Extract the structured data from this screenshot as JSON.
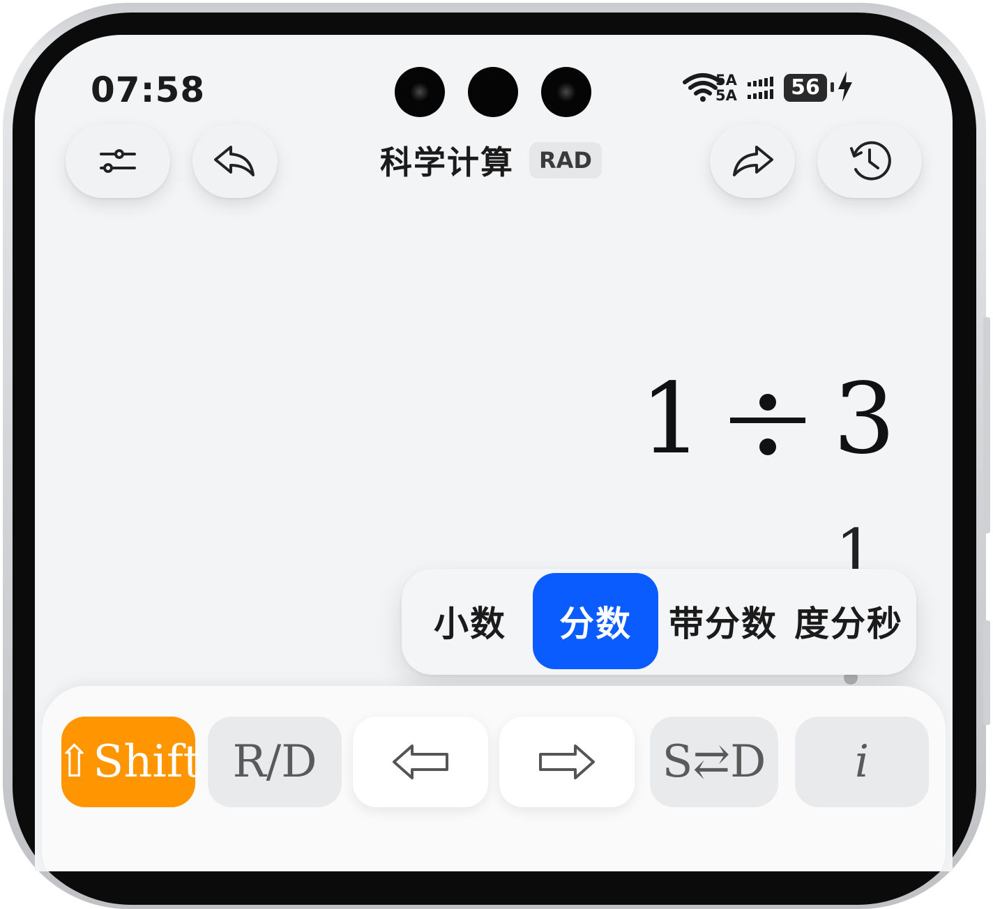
{
  "status_bar": {
    "time": "07:58",
    "network_top": "5A",
    "network_bottom": "5A",
    "battery": "56",
    "icons": [
      "wifi-icon",
      "signal-bars-icon",
      "battery-icon",
      "charging-bolt-icon"
    ]
  },
  "header": {
    "title": "科学计算",
    "mode_badge": "RAD",
    "buttons": [
      "settings-sliders-icon",
      "undo-icon",
      "redo-icon",
      "history-clock-icon"
    ]
  },
  "display": {
    "expression_left": "1",
    "operator": "÷",
    "expression_right": "3",
    "result_partial": "1"
  },
  "format_popup": {
    "options": [
      "小数",
      "分数",
      "带分数",
      "度分秒"
    ],
    "selected": "分数"
  },
  "keypad": {
    "row1": [
      "⇧Shift",
      "R/D",
      "⇦",
      "⇨",
      "S⇄D",
      "i"
    ]
  },
  "colors": {
    "screen_bg": "#f3f4f6",
    "accent_blue": "#0a5cff",
    "shift_orange": "#ff9500"
  }
}
